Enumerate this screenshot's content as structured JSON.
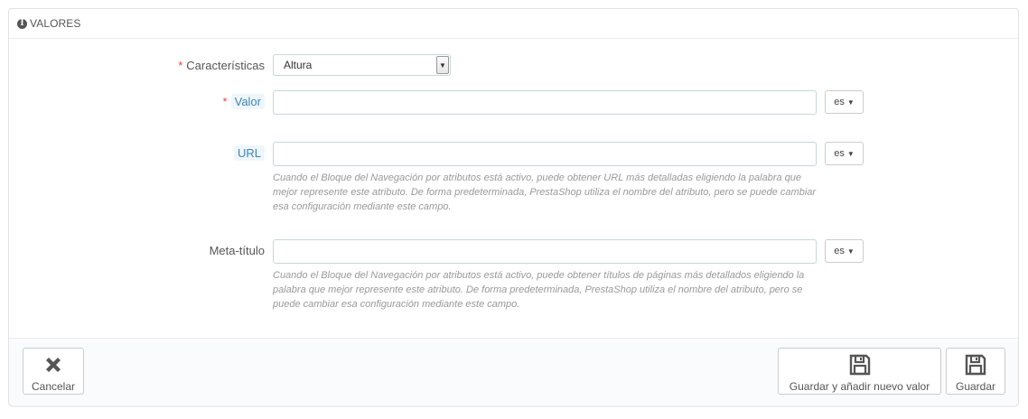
{
  "panel": {
    "title": "VALORES"
  },
  "fields": {
    "caracteristicas": {
      "label": "Características",
      "value": "Altura"
    },
    "valor": {
      "label": "Valor",
      "value": "",
      "lang": "es"
    },
    "url": {
      "label": "URL",
      "value": "",
      "lang": "es",
      "help": "Cuando el Bloque del Navegación por atributos está activo, puede obtener URL más detalladas eligiendo la palabra que mejor represente este atributo. De forma predeterminada, PrestaShop utiliza el nombre del atributo, pero se puede cambiar esa configuración mediante este campo."
    },
    "meta": {
      "label": "Meta-título",
      "value": "",
      "lang": "es",
      "help": "Cuando el Bloque del Navegación por atributos está activo, puede obtener títulos de páginas más detallados eligiendo la palabra que mejor represente este atributo. De forma predeterminada, PrestaShop utiliza el nombre del atributo, pero se puede cambiar esa configuración mediante este campo."
    }
  },
  "footer": {
    "cancel": "Cancelar",
    "save_add": "Guardar y añadir nuevo valor",
    "save": "Guardar"
  }
}
